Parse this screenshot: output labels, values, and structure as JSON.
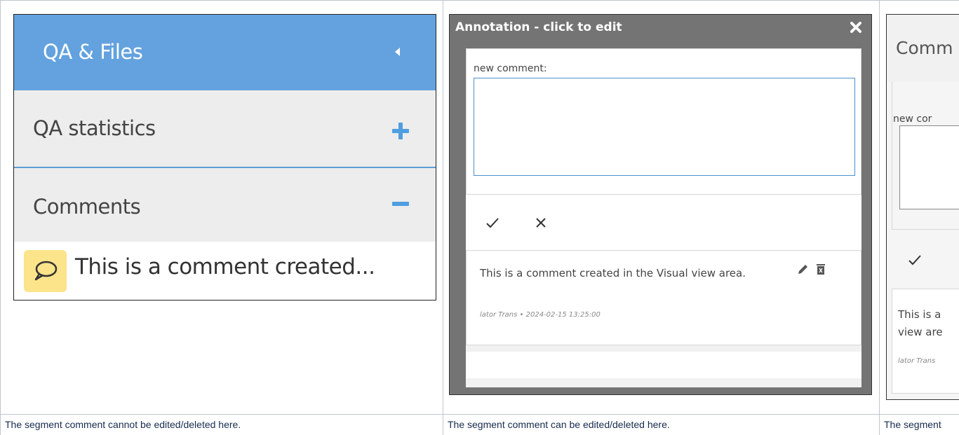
{
  "panels": [
    {
      "sidebar": {
        "header_title": "QA & Files",
        "sections": [
          {
            "label": "QA statistics",
            "state": "collapsed",
            "icon": "plus-icon"
          },
          {
            "label": "Comments",
            "state": "expanded",
            "icon": "minus-icon"
          }
        ],
        "comment_preview": "This is a comment created..."
      },
      "caption": "The segment comment cannot be edited/deleted here."
    },
    {
      "annotation_window": {
        "title": "Annotation - click to edit",
        "form_label": "new comment:",
        "comment_text": "This is a comment created in the Visual view area.",
        "comment_meta": "lator Trans  •  2024-02-15 13:25:00"
      },
      "caption": "The segment comment can be edited/deleted here."
    },
    {
      "comment_panel": {
        "title": "Comm",
        "form_label": "new cor",
        "comment_line_1": "This is a",
        "comment_line_2": "view are",
        "comment_meta": "lator Trans"
      },
      "caption": "The segment"
    }
  ],
  "colors": {
    "sidebar_header": "#63a2df",
    "accent_blue": "#4f9ee0",
    "section_bg": "#ededed",
    "comment_bubble": "#fbe48a",
    "window_frame": "#747474",
    "grid": "#c1c7d0"
  }
}
